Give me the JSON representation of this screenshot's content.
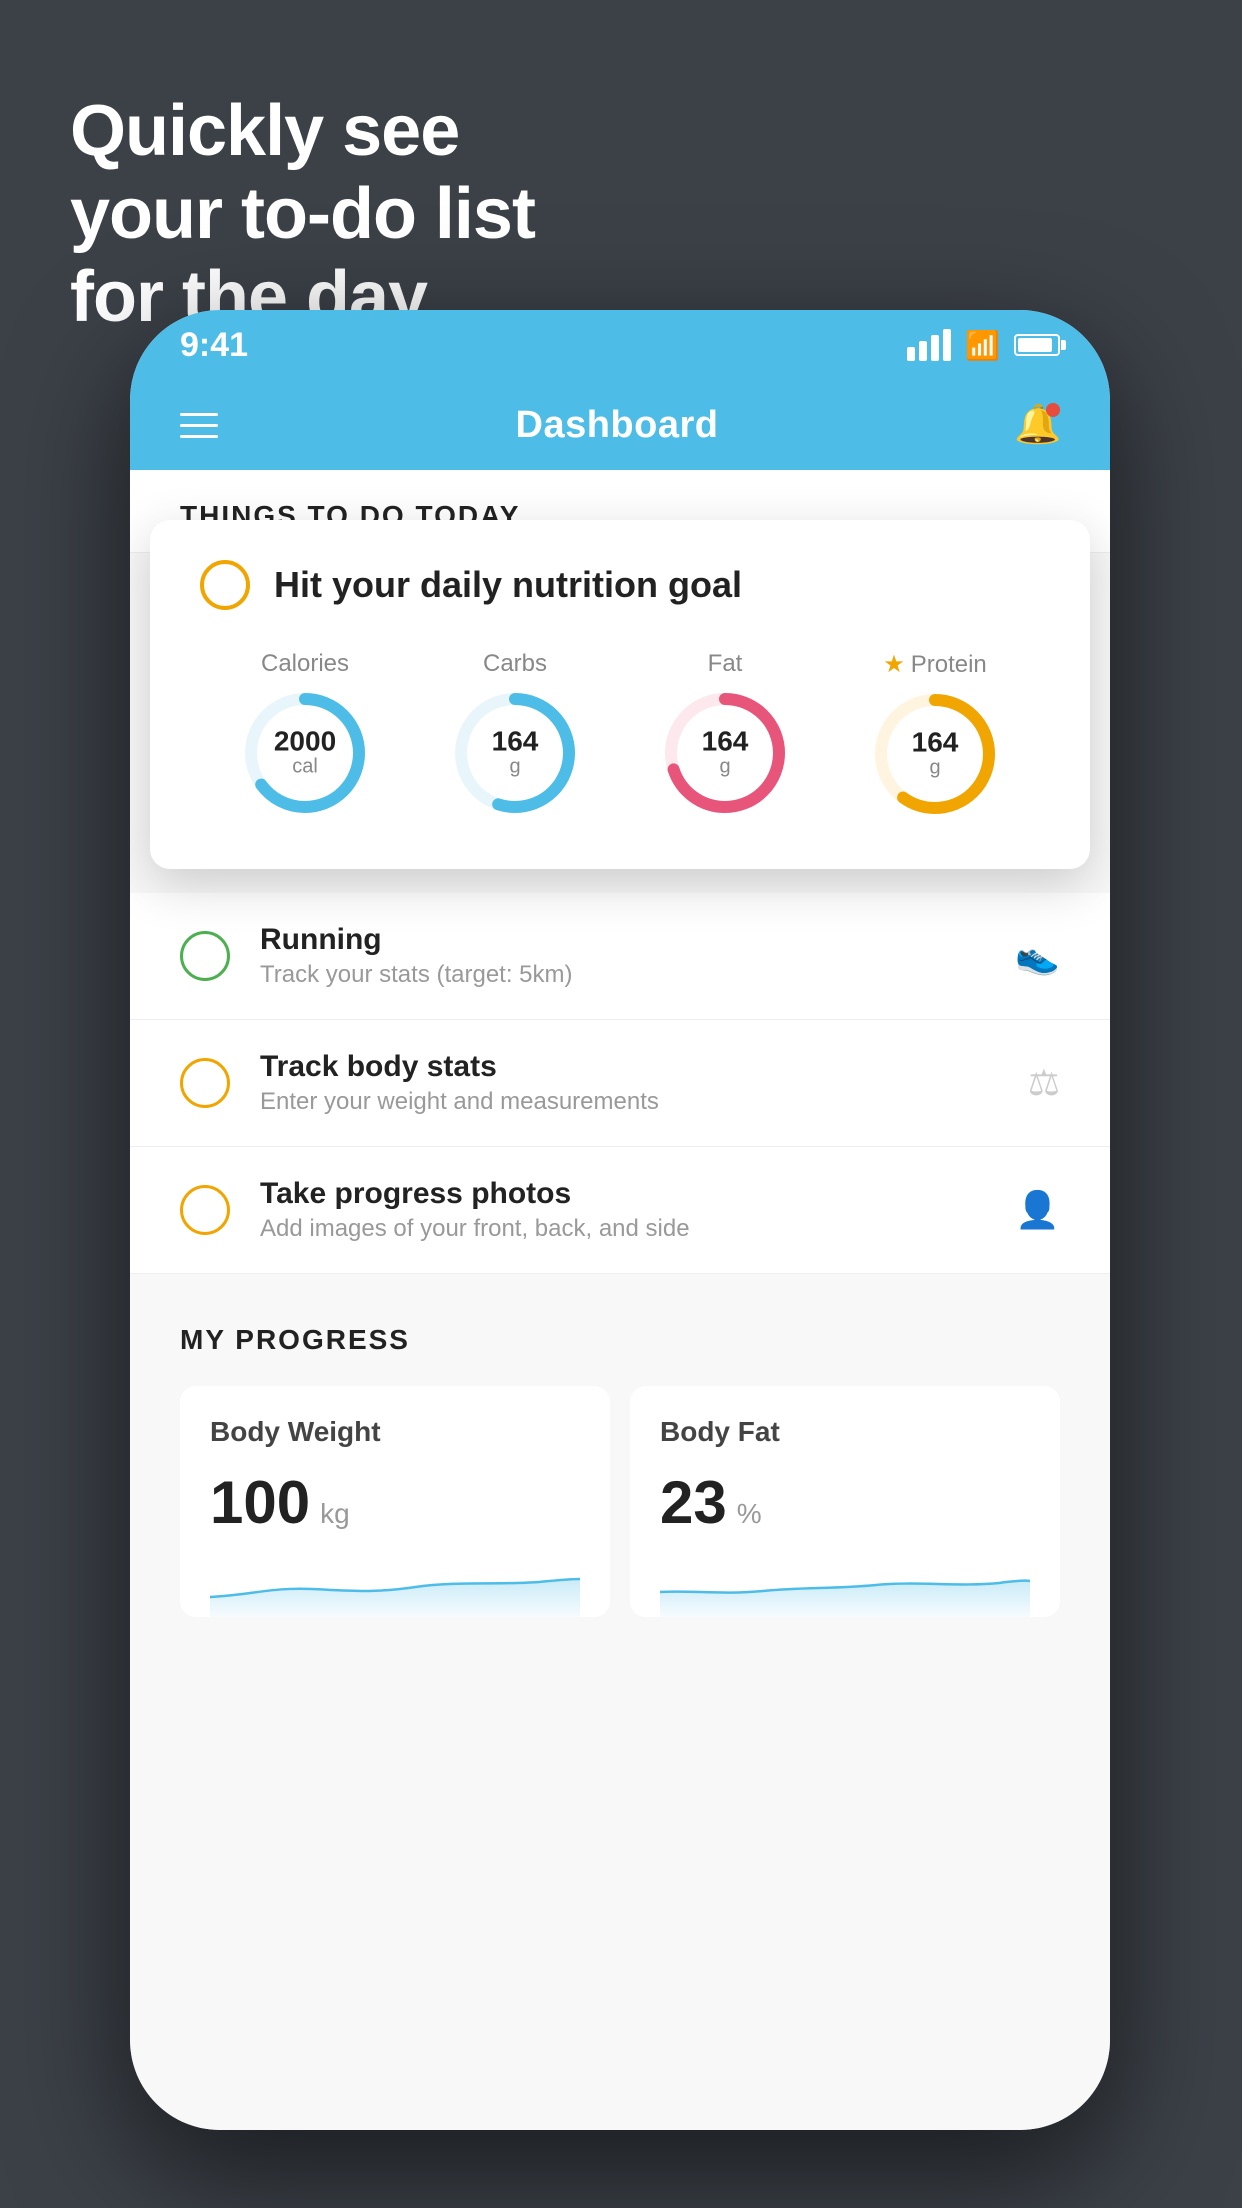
{
  "background_color": "#3c4148",
  "headline": {
    "line1": "Quickly see",
    "line2": "your to-do list",
    "line3": "for the day."
  },
  "status_bar": {
    "time": "9:41",
    "signal_label": "signal",
    "wifi_label": "wifi",
    "battery_label": "battery"
  },
  "nav": {
    "title": "Dashboard",
    "menu_label": "menu",
    "bell_label": "notifications"
  },
  "things_to_do": {
    "section_title": "THINGS TO DO TODAY",
    "floating_card": {
      "title": "Hit your daily nutrition goal",
      "items": [
        {
          "label": "Calories",
          "value": "2000",
          "unit": "cal",
          "color": "#4dbde8",
          "percent": 65
        },
        {
          "label": "Carbs",
          "value": "164",
          "unit": "g",
          "color": "#4dbde8",
          "percent": 55
        },
        {
          "label": "Fat",
          "value": "164",
          "unit": "g",
          "color": "#e8557a",
          "percent": 70
        },
        {
          "label": "Protein",
          "value": "164",
          "unit": "g",
          "color": "#f0a500",
          "percent": 60,
          "starred": true
        }
      ]
    },
    "todo_items": [
      {
        "name": "Running",
        "sub": "Track your stats (target: 5km)",
        "circle": "green",
        "icon": "👟"
      },
      {
        "name": "Track body stats",
        "sub": "Enter your weight and measurements",
        "circle": "yellow",
        "icon": "⚖️"
      },
      {
        "name": "Take progress photos",
        "sub": "Add images of your front, back, and side",
        "circle": "yellow",
        "icon": "👤"
      }
    ]
  },
  "my_progress": {
    "section_title": "MY PROGRESS",
    "cards": [
      {
        "title": "Body Weight",
        "value": "100",
        "unit": "kg"
      },
      {
        "title": "Body Fat",
        "value": "23",
        "unit": "%"
      }
    ]
  }
}
